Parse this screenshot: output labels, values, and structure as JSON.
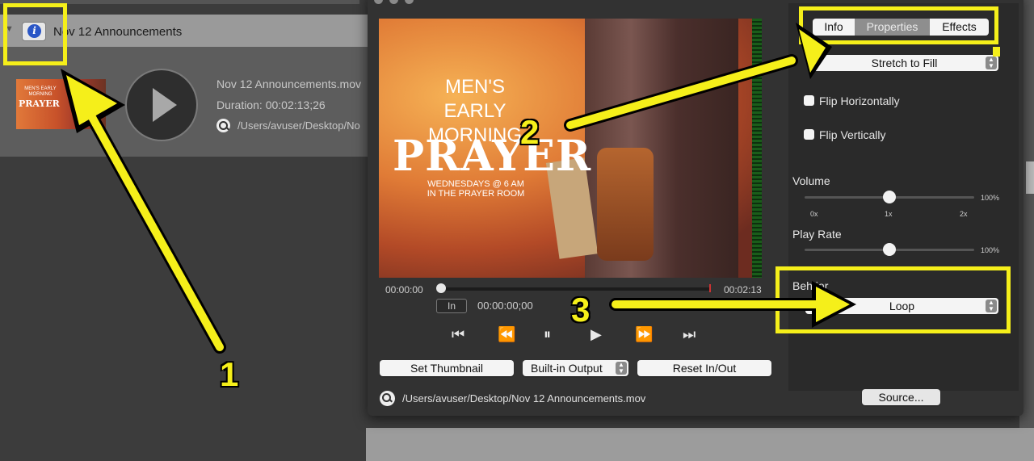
{
  "media_list": {
    "header_title": "Nov 12 Announcements",
    "info_icon": "info-icon",
    "item": {
      "filename": "Nov 12 Announcements.mov",
      "duration": "Duration: 00:02:13;26",
      "path": "/Users/avuser/Desktop/No",
      "thumb_line1": "MEN'S EARLY MORNING",
      "thumb_line2": "PRAYER"
    }
  },
  "player": {
    "video_title_line1": "MEN'S EARLY MORNING",
    "video_title_line2": "PRAYER",
    "video_title_line3": "WEDNESDAYS @ 6 AM\nIN THE PRAYER ROOM",
    "time_start": "00:00:00",
    "time_end": "00:02:13",
    "in_label": "In",
    "in_time": "00:00:00;00",
    "buttons": {
      "set_thumbnail": "Set Thumbnail",
      "output": "Built-in Output",
      "reset": "Reset In/Out"
    },
    "file_path": "/Users/avuser/Desktop/Nov 12 Announcements.mov"
  },
  "panel": {
    "tabs": [
      "Info",
      "Properties",
      "Effects"
    ],
    "selected_tab": "Properties",
    "scaling": "Stretch to Fill",
    "flip_h": "Flip Horizontally",
    "flip_v": "Flip Vertically",
    "volume_label": "Volume",
    "volume_value": "100%",
    "volume_level": 0.5,
    "scale_ticks": [
      "0x",
      "1x",
      "2x"
    ],
    "play_rate_label": "Play Rate",
    "play_rate_value": "100%",
    "play_rate_level": 0.5,
    "behavior_label": "Beh ior",
    "behavior_value": "Loop",
    "source_button": "Source..."
  },
  "annotations": {
    "numbers": [
      "1",
      "2",
      "3"
    ],
    "color": "#f5ef1a"
  }
}
